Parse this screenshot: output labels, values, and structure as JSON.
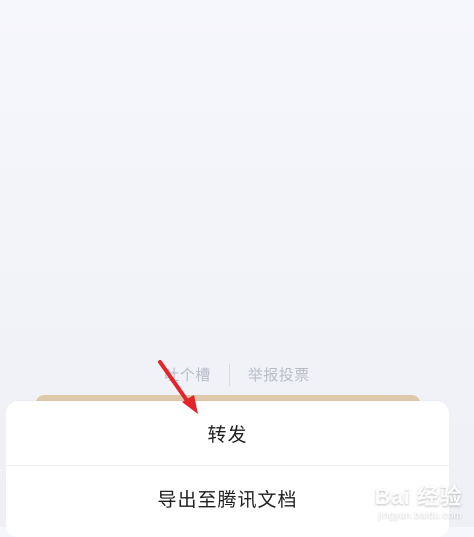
{
  "background": {
    "links": {
      "left": "吐个槽",
      "right": "举报投票"
    }
  },
  "action_sheet": {
    "items": [
      {
        "label": "转发"
      },
      {
        "label": "导出至腾讯文档"
      }
    ]
  },
  "watermark": {
    "main": "Bai 经验",
    "sub": "jingyan.baidu.com"
  },
  "icons": {
    "annotation_arrow": "red-arrow-icon"
  },
  "colors": {
    "arrow": "#e3242b",
    "muted_text": "#b9bcc6"
  }
}
